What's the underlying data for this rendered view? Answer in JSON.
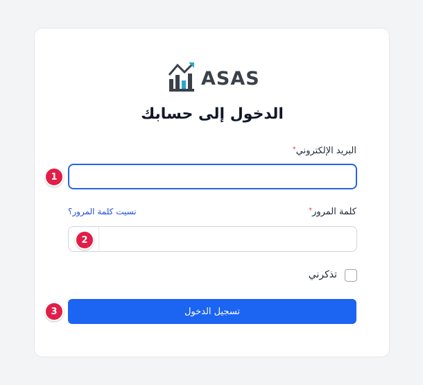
{
  "brand": {
    "name": "ASAS",
    "logo_icon": "chart-bars-arrow-icon",
    "logo_colors": [
      "#3b4148",
      "#2aa7c9"
    ]
  },
  "page": {
    "title": "الدخول إلى حسابك"
  },
  "form": {
    "email": {
      "label": "البريد الإلكتروني",
      "required_mark": "*",
      "value": ""
    },
    "password": {
      "label": "كلمة المرور",
      "required_mark": "*",
      "value": "",
      "forgot_link": "نسيت كلمة المرور؟"
    },
    "remember": {
      "label": "تذكرني",
      "checked": false
    },
    "submit_label": "تسجيل الدخول"
  },
  "markers": [
    "1",
    "2",
    "3"
  ],
  "colors": {
    "primary": "#1c64f2",
    "marker": "#e11d48",
    "link": "#1d4ed8",
    "required": "#ef4444"
  }
}
